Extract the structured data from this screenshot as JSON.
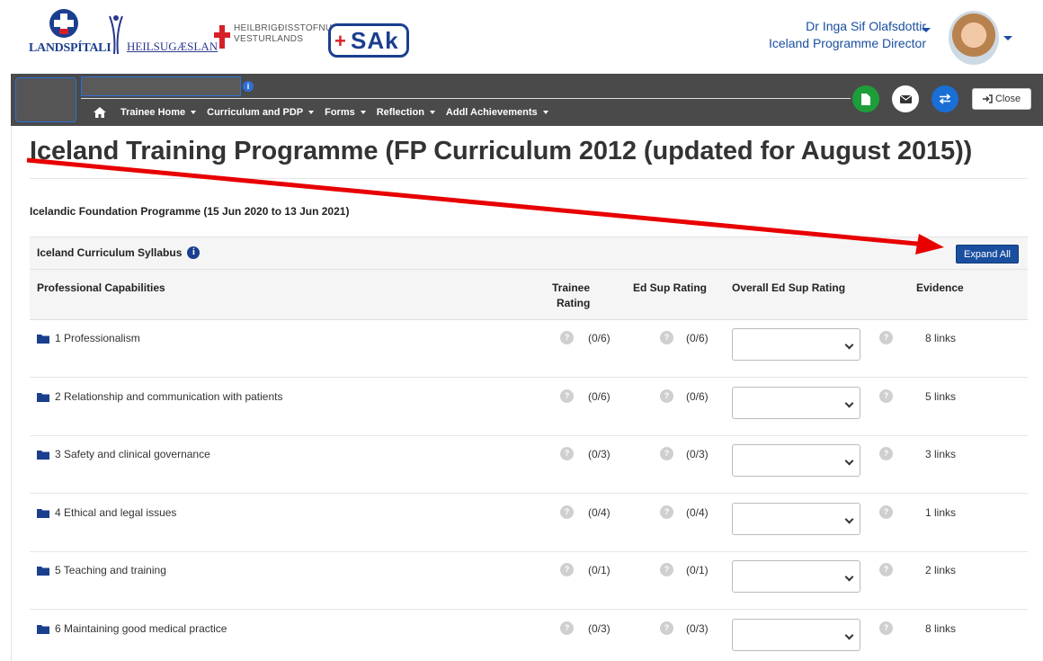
{
  "header": {
    "logos": {
      "landspitali": "LANDSPÍTALI",
      "heilsugaeslan": "HEILSUGÆSLAN",
      "hve_line1": "HEILBRIGÐISSTOFNUN",
      "hve_line2": "VESTURLANDS",
      "sak": "SAk"
    },
    "user": {
      "name": "Dr Inga Sif Olafsdottir",
      "role": "Iceland Programme Director"
    }
  },
  "navbar": {
    "info_icon": "i",
    "menu": [
      {
        "label": "Trainee Home"
      },
      {
        "label": "Curriculum and PDP"
      },
      {
        "label": "Forms"
      },
      {
        "label": "Reflection"
      },
      {
        "label": "Addl Achievements"
      }
    ],
    "close_label": "Close",
    "colors": {
      "bar": "#4a4a4a",
      "green": "#1e9e3a",
      "blue": "#1a6fd6",
      "accent": "#1a4fa0"
    }
  },
  "main": {
    "title": "Iceland Training Programme (FP Curriculum 2012 (updated for August 2015))",
    "programme": "Icelandic Foundation Programme (15 Jun 2020 to 13 Jun 2021)",
    "syllabus_title": "Iceland Curriculum Syllabus",
    "expand_label": "Expand All",
    "columns": {
      "capabilities": "Professional Capabilities",
      "trainee_line1": "Trainee",
      "trainee_line2": "Rating",
      "edsup": "Ed Sup Rating",
      "overall": "Overall Ed Sup Rating",
      "evidence": "Evidence"
    },
    "rows": [
      {
        "label": "1 Professionalism",
        "trainee": "(0/6)",
        "edsup": "(0/6)",
        "evidence": "8 links"
      },
      {
        "label": "2 Relationship and communication with patients",
        "trainee": "(0/6)",
        "edsup": "(0/6)",
        "evidence": "5 links"
      },
      {
        "label": "3 Safety and clinical governance",
        "trainee": "(0/3)",
        "edsup": "(0/3)",
        "evidence": "3 links"
      },
      {
        "label": "4 Ethical and legal issues",
        "trainee": "(0/4)",
        "edsup": "(0/4)",
        "evidence": "1 links"
      },
      {
        "label": "5 Teaching and training",
        "trainee": "(0/1)",
        "edsup": "(0/1)",
        "evidence": "2 links"
      },
      {
        "label": "6 Maintaining good medical practice",
        "trainee": "(0/3)",
        "edsup": "(0/3)",
        "evidence": "8 links"
      }
    ],
    "help_glyph": "?"
  },
  "annotation": {
    "arrow_color": "#e80000"
  }
}
